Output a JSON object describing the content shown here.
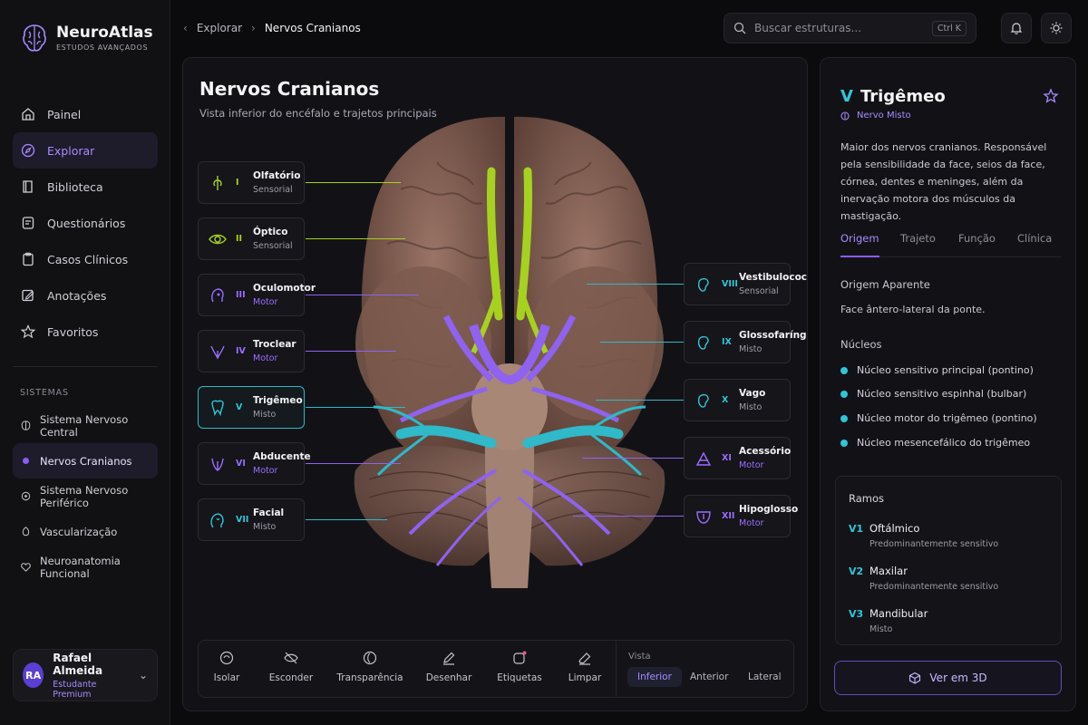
{
  "app": {
    "name": "NeuroAtlas",
    "subtitle": "ESTUDOS AVANÇADOS"
  },
  "nav": [
    {
      "label": "Painel",
      "icon": "home-icon"
    },
    {
      "label": "Explorar",
      "icon": "compass-icon",
      "active": true
    },
    {
      "label": "Biblioteca",
      "icon": "book-icon"
    },
    {
      "label": "Questionários",
      "icon": "quiz-icon"
    },
    {
      "label": "Casos Clínicos",
      "icon": "clipboard-icon"
    },
    {
      "label": "Anotações",
      "icon": "pencil-icon"
    },
    {
      "label": "Favoritos",
      "icon": "star-icon"
    }
  ],
  "systems": {
    "title": "SISTEMAS",
    "items": [
      {
        "label": "Sistema Nervoso Central"
      },
      {
        "label": "Nervos Cranianos",
        "active": true
      },
      {
        "label": "Sistema Nervoso Periférico"
      },
      {
        "label": "Vascularização"
      },
      {
        "label": "Neuroanatomia Funcional"
      }
    ]
  },
  "user": {
    "initials": "RA",
    "name": "Rafael Almeida",
    "role": "Estudante Premium"
  },
  "breadcrumb": {
    "parent": "Explorar",
    "current": "Nervos Cranianos"
  },
  "search": {
    "placeholder": "Buscar estruturas...",
    "shortcut": "Ctrl K"
  },
  "main": {
    "title": "Nervos Cranianos",
    "subtitle": "Vista inferior do encéfalo e trajetos principais"
  },
  "nerves_left": [
    {
      "num": "I",
      "name": "Olfatório",
      "type": "Sensorial",
      "color": "#a6d21f",
      "icon": "olfactory-icon"
    },
    {
      "num": "II",
      "name": "Óptico",
      "type": "Sensorial",
      "color": "#a6d21f",
      "icon": "eye-icon"
    },
    {
      "num": "III",
      "name": "Oculomotor",
      "type": "Motor",
      "color": "#9b6dff",
      "icon": "head-icon"
    },
    {
      "num": "IV",
      "name": "Troclear",
      "type": "Motor",
      "color": "#9b6dff",
      "icon": "trochlear-icon"
    },
    {
      "num": "V",
      "name": "Trigêmeo",
      "type": "Misto",
      "color": "#2fc6d8",
      "icon": "tooth-icon",
      "selected": true
    },
    {
      "num": "VI",
      "name": "Abducente",
      "type": "Motor",
      "color": "#9b6dff",
      "icon": "abducens-icon"
    },
    {
      "num": "VII",
      "name": "Facial",
      "type": "Misto",
      "color": "#2fc6d8",
      "icon": "face-icon"
    }
  ],
  "nerves_right": [
    {
      "num": "VIII",
      "name": "Vestibulococlear",
      "type": "Sensorial",
      "color": "#2fc6d8",
      "icon": "ear-icon"
    },
    {
      "num": "IX",
      "name": "Glossofaríngeo",
      "type": "Misto",
      "color": "#2fc6d8",
      "icon": "ear-icon"
    },
    {
      "num": "X",
      "name": "Vago",
      "type": "Misto",
      "color": "#2fc6d8",
      "icon": "ear-icon"
    },
    {
      "num": "XI",
      "name": "Acessório",
      "type": "Motor",
      "color": "#9b6dff",
      "icon": "accessory-icon"
    },
    {
      "num": "XII",
      "name": "Hipoglosso",
      "type": "Motor",
      "color": "#9b6dff",
      "icon": "tongue-icon"
    }
  ],
  "tools": [
    {
      "label": "Isolar",
      "icon": "isolate-icon"
    },
    {
      "label": "Esconder",
      "icon": "hide-icon"
    },
    {
      "label": "Transparência",
      "icon": "transparency-icon"
    },
    {
      "label": "Desenhar",
      "icon": "pen-icon"
    },
    {
      "label": "Etiquetas",
      "icon": "tag-icon"
    },
    {
      "label": "Limpar",
      "icon": "eraser-icon"
    }
  ],
  "view": {
    "label": "Vista",
    "options": [
      "Inferior",
      "Anterior",
      "Lateral"
    ],
    "active": "Inferior"
  },
  "detail": {
    "num": "V",
    "title": "Trigêmeo",
    "type": "Nervo Misto",
    "description": "Maior dos nervos cranianos. Responsável pela sensibilidade da face, seios da face, córnea, dentes e meninges, além da inervação motora dos músculos da mastigação.",
    "tabs": [
      "Origem",
      "Trajeto",
      "Função",
      "Clínica"
    ],
    "active_tab": "Origem",
    "origin_title": "Origem Aparente",
    "origin_text": "Face ântero-lateral da ponte.",
    "nuclei_title": "Núcleos",
    "nuclei": [
      "Núcleo sensitivo principal (pontino)",
      "Núcleo sensitivo espinhal (bulbar)",
      "Núcleo motor do trigêmeo (pontino)",
      "Núcleo mesencefálico do trigêmeo"
    ],
    "branches_title": "Ramos",
    "branches": [
      {
        "code": "V1",
        "name": "Oftálmico",
        "desc": "Predominantemente sensitivo"
      },
      {
        "code": "V2",
        "name": "Maxilar",
        "desc": "Predominantemente sensitivo"
      },
      {
        "code": "V3",
        "name": "Mandibular",
        "desc": "Misto"
      }
    ],
    "button_3d": "Ver em 3D"
  },
  "colors": {
    "accent": "#8b5cf6",
    "cyan": "#2fc6d8",
    "lime": "#a6d21f"
  }
}
